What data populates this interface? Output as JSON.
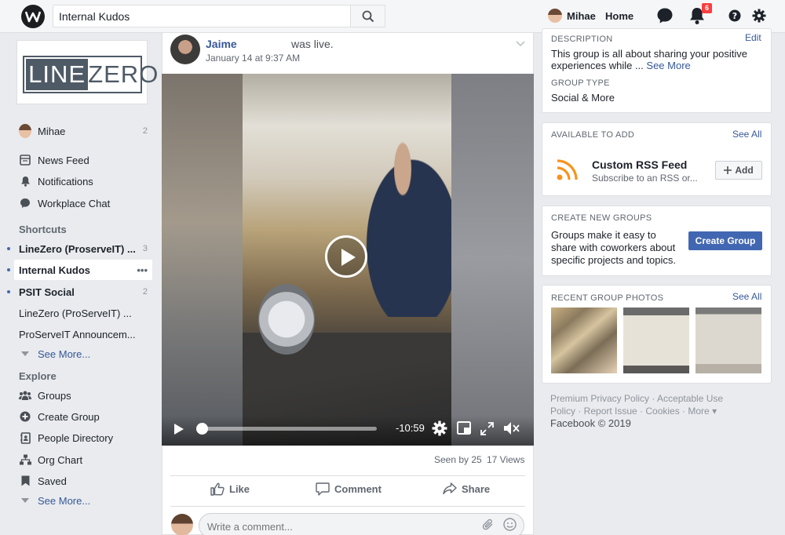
{
  "topbar": {
    "search_value": "Internal Kudos",
    "user_name": "Mihae",
    "home_label": "Home",
    "notification_count": "6"
  },
  "leftnav": {
    "group_logo": {
      "left": "LINE",
      "right": "ZERO"
    },
    "profile": {
      "name": "Mihae",
      "count": "2"
    },
    "items": [
      {
        "label": "News Feed",
        "icon": "news-feed-icon"
      },
      {
        "label": "Notifications",
        "icon": "bell-icon"
      },
      {
        "label": "Workplace Chat",
        "icon": "chat-icon"
      }
    ],
    "shortcuts_heading": "Shortcuts",
    "shortcuts": [
      {
        "label": "LineZero (ProserveIT) ...",
        "count": "3",
        "unread": true
      },
      {
        "label": "Internal Kudos",
        "more": "•••",
        "unread": true,
        "active": true
      },
      {
        "label": "PSIT Social",
        "count": "2",
        "unread": true
      },
      {
        "label": "LineZero (ProServeIT) ...",
        "unread": false
      },
      {
        "label": "ProServeIT Announcem...",
        "unread": false
      }
    ],
    "shortcuts_see_more": "See More...",
    "explore_heading": "Explore",
    "explore": [
      {
        "label": "Groups",
        "icon": "groups-icon"
      },
      {
        "label": "Create Group",
        "icon": "plus-circle-icon"
      },
      {
        "label": "People Directory",
        "icon": "directory-icon"
      },
      {
        "label": "Org Chart",
        "icon": "org-chart-icon"
      },
      {
        "label": "Saved",
        "icon": "bookmark-icon"
      }
    ],
    "explore_see_more": "See More..."
  },
  "post": {
    "author": "Jaime",
    "action": "was live.",
    "timestamp": "January 14 at 9:37 AM",
    "video": {
      "time_remaining": "-10:59",
      "progress": 0.01
    },
    "seen": "Seen by 25",
    "views": "17 Views",
    "actions": {
      "like": "Like",
      "comment": "Comment",
      "share": "Share"
    },
    "comment_placeholder": "Write a comment..."
  },
  "rightcol": {
    "description_heading": "DESCRIPTION",
    "edit": "Edit",
    "description_line1": "This group is all about sharing your positive",
    "description_line2": "experiences while ...",
    "see_more": "See More",
    "group_type_heading": "GROUP TYPE",
    "group_type": "Social & More",
    "available_heading": "AVAILABLE TO ADD",
    "see_all": "See All",
    "rss_title": "Custom RSS Feed",
    "rss_sub": "Subscribe to an RSS or...",
    "add_label": "Add",
    "create_heading": "CREATE NEW GROUPS",
    "create_text_1": "Groups make it easy to",
    "create_text_2": "share with coworkers about",
    "create_text_3": "specific projects and topics.",
    "create_button": "Create Group",
    "photos_heading": "RECENT GROUP PHOTOS",
    "photos_see_all": "See All",
    "footer_line1": "Premium Privacy Policy · Acceptable Use",
    "footer_line2": "Policy · Report Issue · Cookies · More ▾",
    "copyright": "Facebook © 2019"
  },
  "colors": {
    "brand_blue": "#4267b2",
    "link": "#365899",
    "badge": "#fa3e3e"
  }
}
